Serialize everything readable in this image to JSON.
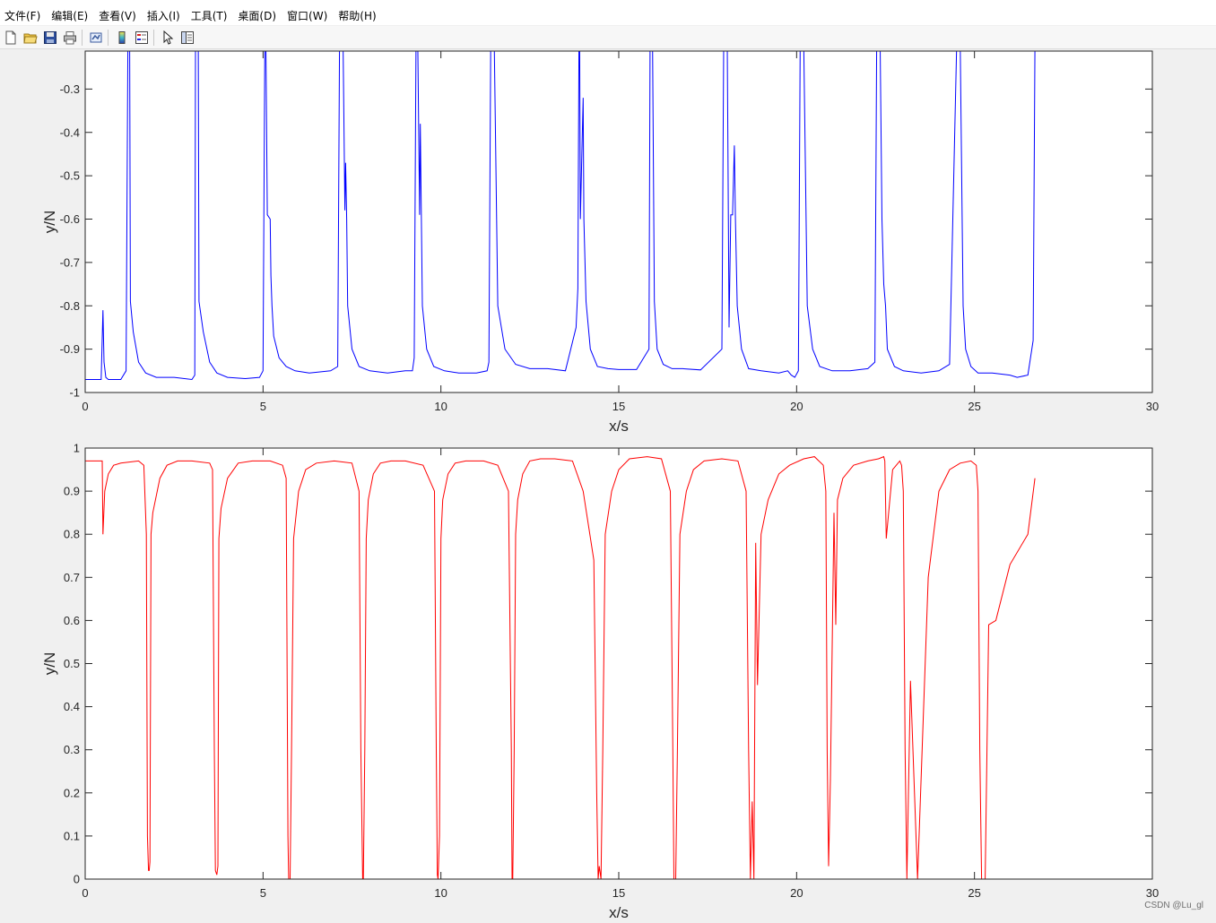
{
  "menu": [
    "文件(F)",
    "编辑(E)",
    "查看(V)",
    "插入(I)",
    "工具(T)",
    "桌面(D)",
    "窗口(W)",
    "帮助(H)"
  ],
  "toolbar": [
    "new-figure-icon",
    "open-file-icon",
    "save-icon",
    "print-icon",
    "link-plot-icon",
    "colorbar-icon",
    "legend-icon",
    "pointer-icon",
    "property-inspector-icon"
  ],
  "watermark": "CSDN @Lu_gl",
  "chart_data": [
    {
      "type": "line",
      "color": "#0000ff",
      "xlabel": "x/s",
      "ylabel": "y/N",
      "xlim": [
        0,
        30
      ],
      "ylim": [
        -1,
        -0.2
      ],
      "xticks": [
        "0",
        "5",
        "10",
        "15",
        "20",
        "25",
        "30"
      ],
      "yticks": [
        "-1",
        "-0.9",
        "-0.8",
        "-0.7",
        "-0.6",
        "-0.5",
        "-0.4",
        "-0.3"
      ],
      "x": [
        0,
        0.45,
        0.5,
        0.53,
        0.58,
        0.65,
        0.8,
        1.0,
        1.15,
        1.2,
        1.22,
        1.25,
        1.27,
        1.35,
        1.5,
        1.7,
        2.0,
        2.5,
        3.0,
        3.08,
        3.1,
        3.15,
        3.18,
        3.2,
        3.32,
        3.5,
        3.7,
        4.0,
        4.5,
        4.9,
        5.0,
        5.05,
        5.08,
        5.12,
        5.2,
        5.22,
        5.25,
        5.3,
        5.45,
        5.65,
        5.9,
        6.3,
        6.9,
        7.1,
        7.15,
        7.2,
        7.25,
        7.3,
        7.32,
        7.35,
        7.38,
        7.5,
        7.7,
        8.0,
        8.5,
        9.0,
        9.2,
        9.25,
        9.3,
        9.35,
        9.4,
        9.42,
        9.45,
        9.48,
        9.6,
        9.8,
        10.1,
        10.5,
        11.0,
        11.3,
        11.35,
        11.4,
        11.45,
        11.5,
        11.6,
        11.8,
        12.1,
        12.5,
        13.0,
        13.5,
        13.8,
        13.85,
        13.88,
        13.9,
        13.92,
        13.95,
        14.0,
        14.02,
        14.08,
        14.2,
        14.4,
        14.7,
        15.0,
        15.5,
        15.85,
        15.88,
        15.92,
        15.95,
        16.0,
        16.08,
        16.25,
        16.5,
        16.8,
        17.3,
        17.9,
        17.95,
        18.0,
        18.05,
        18.1,
        18.15,
        18.2,
        18.25,
        18.28,
        18.33,
        18.45,
        18.65,
        19.0,
        19.5,
        19.75,
        19.85,
        19.95,
        20.05,
        20.1,
        20.15,
        20.2,
        20.3,
        20.45,
        20.65,
        21.0,
        21.5,
        22.0,
        22.2,
        22.25,
        22.3,
        22.35,
        22.4,
        22.45,
        22.5,
        22.55,
        22.75,
        23.0,
        23.5,
        24.0,
        24.3,
        24.5,
        24.55,
        24.6,
        24.68,
        24.75,
        24.9,
        25.1,
        25.5,
        26.0,
        26.2,
        26.5,
        26.65,
        26.7,
        26.75
      ],
      "y": [
        -0.97,
        -0.97,
        -0.81,
        -0.93,
        -0.965,
        -0.97,
        -0.97,
        -0.97,
        -0.95,
        -0.2,
        -0.2,
        -0.2,
        -0.79,
        -0.86,
        -0.93,
        -0.955,
        -0.965,
        -0.965,
        -0.97,
        -0.96,
        -0.2,
        -0.2,
        -0.2,
        -0.79,
        -0.86,
        -0.93,
        -0.955,
        -0.965,
        -0.968,
        -0.965,
        -0.95,
        -0.2,
        -0.2,
        -0.59,
        -0.6,
        -0.73,
        -0.8,
        -0.87,
        -0.92,
        -0.94,
        -0.95,
        -0.955,
        -0.95,
        -0.94,
        -0.2,
        -0.2,
        -0.2,
        -0.58,
        -0.47,
        -0.6,
        -0.8,
        -0.9,
        -0.94,
        -0.95,
        -0.955,
        -0.95,
        -0.95,
        -0.92,
        -0.2,
        -0.2,
        -0.59,
        -0.38,
        -0.6,
        -0.8,
        -0.9,
        -0.94,
        -0.95,
        -0.955,
        -0.955,
        -0.95,
        -0.93,
        -0.2,
        -0.2,
        -0.2,
        -0.8,
        -0.9,
        -0.935,
        -0.945,
        -0.945,
        -0.95,
        -0.85,
        -0.76,
        -0.2,
        -0.2,
        -0.6,
        -0.5,
        -0.32,
        -0.6,
        -0.79,
        -0.9,
        -0.94,
        -0.945,
        -0.947,
        -0.947,
        -0.9,
        -0.2,
        -0.2,
        -0.2,
        -0.79,
        -0.9,
        -0.935,
        -0.945,
        -0.945,
        -0.948,
        -0.9,
        -0.2,
        -0.2,
        -0.2,
        -0.85,
        -0.59,
        -0.59,
        -0.43,
        -0.6,
        -0.8,
        -0.9,
        -0.945,
        -0.95,
        -0.955,
        -0.95,
        -0.96,
        -0.965,
        -0.95,
        -0.2,
        -0.2,
        -0.2,
        -0.8,
        -0.9,
        -0.94,
        -0.95,
        -0.95,
        -0.945,
        -0.93,
        -0.2,
        -0.2,
        -0.2,
        -0.6,
        -0.75,
        -0.8,
        -0.9,
        -0.94,
        -0.95,
        -0.955,
        -0.95,
        -0.935,
        -0.2,
        -0.2,
        -0.2,
        -0.8,
        -0.9,
        -0.94,
        -0.955,
        -0.955,
        -0.96,
        -0.965,
        -0.96,
        -0.88,
        -0.2,
        -0.2
      ]
    },
    {
      "type": "line",
      "color": "#ff0000",
      "xlabel": "x/s",
      "ylabel": "y/N",
      "xlim": [
        0,
        30
      ],
      "ylim": [
        0,
        1
      ],
      "xticks": [
        "0",
        "5",
        "10",
        "15",
        "20",
        "25",
        "30"
      ],
      "yticks": [
        "0",
        "0.1",
        "0.2",
        "0.3",
        "0.4",
        "0.5",
        "0.6",
        "0.7",
        "0.8",
        "0.9",
        "1"
      ],
      "x": [
        0,
        0.48,
        0.5,
        0.55,
        0.65,
        0.8,
        1.0,
        1.5,
        1.65,
        1.72,
        1.75,
        1.78,
        1.8,
        1.82,
        1.85,
        1.9,
        2.1,
        2.3,
        2.6,
        3.0,
        3.5,
        3.58,
        3.63,
        3.66,
        3.7,
        3.73,
        3.76,
        3.82,
        4.0,
        4.3,
        4.7,
        5.2,
        5.55,
        5.65,
        5.7,
        5.72,
        5.76,
        5.8,
        5.86,
        6.0,
        6.2,
        6.5,
        7.0,
        7.5,
        7.7,
        7.75,
        7.8,
        7.82,
        7.86,
        7.9,
        7.96,
        8.1,
        8.3,
        8.6,
        9.0,
        9.5,
        9.82,
        9.87,
        9.9,
        9.92,
        9.96,
        10.0,
        10.05,
        10.2,
        10.4,
        10.7,
        11.2,
        11.6,
        11.9,
        11.98,
        12.0,
        12.02,
        12.06,
        12.1,
        12.16,
        12.3,
        12.5,
        12.8,
        13.2,
        13.7,
        14.0,
        14.3,
        14.38,
        14.42,
        14.45,
        14.5,
        14.55,
        14.62,
        14.8,
        15.0,
        15.3,
        15.8,
        16.2,
        16.45,
        16.52,
        16.55,
        16.6,
        16.65,
        16.72,
        16.9,
        17.1,
        17.4,
        17.9,
        18.35,
        18.58,
        18.65,
        18.7,
        18.75,
        18.8,
        18.85,
        18.9,
        19.0,
        19.2,
        19.5,
        19.8,
        20.2,
        20.5,
        20.75,
        20.82,
        20.86,
        20.9,
        20.95,
        21.05,
        21.1,
        21.15,
        21.3,
        21.6,
        22.0,
        22.3,
        22.45,
        22.48,
        22.52,
        22.7,
        22.9,
        22.95,
        23.0,
        23.05,
        23.1,
        23.2,
        23.4,
        23.7,
        24.0,
        24.3,
        24.6,
        24.9,
        25.05,
        25.1,
        25.15,
        25.2,
        25.3,
        25.35,
        25.4,
        25.6,
        26.0,
        26.5,
        26.7
      ],
      "y": [
        0.97,
        0.97,
        0.8,
        0.9,
        0.94,
        0.96,
        0.965,
        0.97,
        0.96,
        0.8,
        0.1,
        0.02,
        0.02,
        0.04,
        0.8,
        0.85,
        0.93,
        0.96,
        0.97,
        0.97,
        0.965,
        0.95,
        0.3,
        0.02,
        0.01,
        0.03,
        0.79,
        0.86,
        0.93,
        0.965,
        0.97,
        0.97,
        0.96,
        0.93,
        0.1,
        0.0,
        0.0,
        0.3,
        0.79,
        0.9,
        0.95,
        0.965,
        0.97,
        0.965,
        0.9,
        0.3,
        0.0,
        0.0,
        0.3,
        0.79,
        0.88,
        0.94,
        0.965,
        0.97,
        0.97,
        0.96,
        0.9,
        0.3,
        0.01,
        0.0,
        0.1,
        0.79,
        0.88,
        0.94,
        0.965,
        0.97,
        0.97,
        0.96,
        0.9,
        0.3,
        0.0,
        0.0,
        0.3,
        0.8,
        0.88,
        0.94,
        0.97,
        0.975,
        0.975,
        0.97,
        0.9,
        0.74,
        0.2,
        0.0,
        0.03,
        0.0,
        0.3,
        0.8,
        0.9,
        0.95,
        0.975,
        0.98,
        0.975,
        0.9,
        0.3,
        0.0,
        0.0,
        0.3,
        0.8,
        0.9,
        0.95,
        0.97,
        0.975,
        0.97,
        0.9,
        0.3,
        0.0,
        0.18,
        0.0,
        0.78,
        0.45,
        0.8,
        0.88,
        0.94,
        0.96,
        0.975,
        0.98,
        0.96,
        0.9,
        0.3,
        0.03,
        0.23,
        0.85,
        0.59,
        0.88,
        0.93,
        0.96,
        0.97,
        0.975,
        0.98,
        0.97,
        0.79,
        0.95,
        0.97,
        0.96,
        0.9,
        0.3,
        0.0,
        0.46,
        0.0,
        0.7,
        0.9,
        0.95,
        0.965,
        0.97,
        0.96,
        0.9,
        0.3,
        0.0,
        0.0,
        0.3,
        0.59,
        0.6,
        0.73,
        0.8,
        0.93,
        0.96,
        0.963
      ]
    }
  ]
}
